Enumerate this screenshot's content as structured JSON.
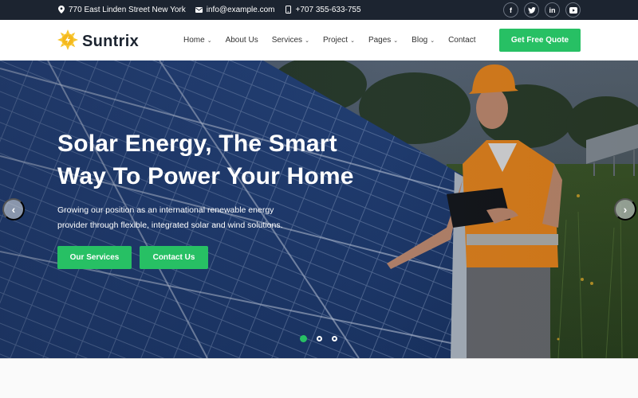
{
  "topbar": {
    "address": "770 East Linden Street New York",
    "email": "info@example.com",
    "phone": "+707 355-633-755",
    "social": [
      {
        "name": "facebook",
        "glyph": "f"
      },
      {
        "name": "twitter",
        "glyph": "t"
      },
      {
        "name": "linkedin",
        "glyph": "in"
      },
      {
        "name": "youtube",
        "glyph": "▶"
      }
    ]
  },
  "brand": {
    "name": "Suntrix"
  },
  "nav": {
    "items": [
      {
        "label": "Home",
        "dropdown": true
      },
      {
        "label": "About Us",
        "dropdown": false
      },
      {
        "label": "Services",
        "dropdown": true
      },
      {
        "label": "Project",
        "dropdown": true
      },
      {
        "label": "Pages",
        "dropdown": true
      },
      {
        "label": "Blog",
        "dropdown": true
      },
      {
        "label": "Contact",
        "dropdown": false
      }
    ],
    "cta_label": "Get Free Quote",
    "chevron": "⌄"
  },
  "hero": {
    "title": "Solar Energy, The Smart Way To Power Your Home",
    "description": "Growing our position as an international renewable energy provider through flexible, integrated solar and wind solutions.",
    "primary_button": "Our Services",
    "secondary_button": "Contact Us",
    "prev_glyph": "‹",
    "next_glyph": "›",
    "slides_total": 3,
    "active_slide": 1
  },
  "colors": {
    "accent": "#27c064",
    "topbar": "#1c2430",
    "brand_text": "#1c2430"
  }
}
